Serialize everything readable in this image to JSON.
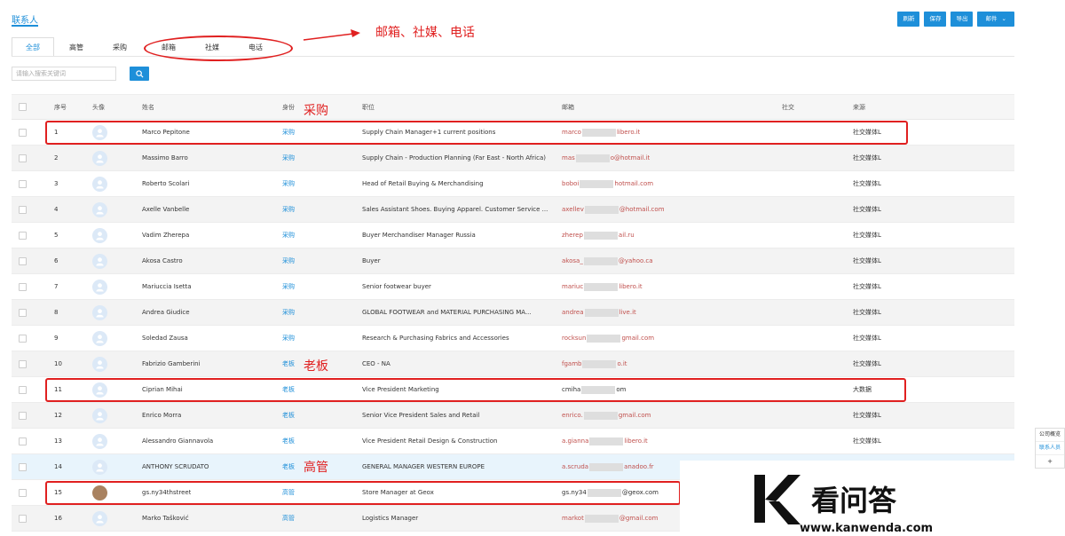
{
  "page": {
    "title": "联系人"
  },
  "tabs": [
    "全部",
    "高管",
    "采购",
    "邮箱",
    "社媒",
    "电话"
  ],
  "search": {
    "placeholder": "请输入搜索关键词"
  },
  "toolbar": {
    "refresh": "刷新",
    "save": "保存",
    "export": "导出",
    "mail": "邮件"
  },
  "table": {
    "headers": {
      "index": "序号",
      "avatar": "头像",
      "name": "姓名",
      "role": "身份",
      "position": "职位",
      "email": "邮箱",
      "social": "社交",
      "source": "来源"
    },
    "rows": [
      {
        "index": "1",
        "name": "Marco Pepitone",
        "role": "采购",
        "position": "Supply Chain Manager+1 current positions",
        "email_prefix": "marco",
        "email_suffix": "libero.it",
        "source": "社交媒体L"
      },
      {
        "index": "2",
        "name": "Massimo Barro",
        "role": "采购",
        "position": "Supply Chain - Production Planning (Far East - North Africa)",
        "email_prefix": "mas",
        "email_suffix": "o@hotmail.it",
        "source": "社交媒体L"
      },
      {
        "index": "3",
        "name": "Roberto Scolari",
        "role": "采购",
        "position": "Head of Retail Buying & Merchandising",
        "email_prefix": "boboi",
        "email_suffix": "hotmail.com",
        "source": "社交媒体L"
      },
      {
        "index": "4",
        "name": "Axelle Vanbelle",
        "role": "采购",
        "position": "Sales Assistant Shoes. Buying Apparel. Customer Service ...",
        "email_prefix": "axellev",
        "email_suffix": "@hotmail.com",
        "source": "社交媒体L"
      },
      {
        "index": "5",
        "name": "Vadim Zherepa",
        "role": "采购",
        "position": "Buyer Merchandiser Manager Russia",
        "email_prefix": "zherep",
        "email_suffix": "ail.ru",
        "source": "社交媒体L"
      },
      {
        "index": "6",
        "name": "Akosa Castro",
        "role": "采购",
        "position": "Buyer",
        "email_prefix": "akosa_",
        "email_suffix": "@yahoo.ca",
        "source": "社交媒体L"
      },
      {
        "index": "7",
        "name": "Mariuccia Isetta",
        "role": "采购",
        "position": "Senior footwear buyer",
        "email_prefix": "mariuc",
        "email_suffix": "libero.it",
        "source": "社交媒体L"
      },
      {
        "index": "8",
        "name": "Andrea Giudice",
        "role": "采购",
        "position": "GLOBAL FOOTWEAR and MATERIAL PURCHASING MA...",
        "email_prefix": "andrea",
        "email_suffix": "live.it",
        "source": "社交媒体L"
      },
      {
        "index": "9",
        "name": "Soledad Zausa",
        "role": "采购",
        "position": "Research & Purchasing Fabrics and Accessories",
        "email_prefix": "rocksun",
        "email_suffix": "gmail.com",
        "source": "社交媒体L"
      },
      {
        "index": "10",
        "name": "Fabrizio Gamberini",
        "role": "老板",
        "position": "CEO - NA",
        "email_prefix": "fgamb",
        "email_suffix": "o.it",
        "source": "社交媒体L"
      },
      {
        "index": "11",
        "name": "Ciprian Mihai",
        "role": "老板",
        "position": "Vice President Marketing",
        "email_prefix": "cmiha",
        "email_suffix": "om",
        "source": "大数据"
      },
      {
        "index": "12",
        "name": "Enrico Morra",
        "role": "老板",
        "position": "Senior Vice President Sales and Retail",
        "email_prefix": "enrico.",
        "email_suffix": "gmail.com",
        "source": "社交媒体L"
      },
      {
        "index": "13",
        "name": "Alessandro Giannavola",
        "role": "老板",
        "position": "Vice President Retail Design & Construction",
        "email_prefix": "a.gianna",
        "email_suffix": "libero.it",
        "source": "社交媒体L"
      },
      {
        "index": "14",
        "name": "ANTHONY SCRUDATO",
        "role": "老板",
        "position": "GENERAL MANAGER WESTERN EUROPE",
        "email_prefix": "a.scruda",
        "email_suffix": "anadoo.fr",
        "source": ""
      },
      {
        "index": "15",
        "name": "gs.ny34thstreet",
        "role": "高管",
        "position": "Store Manager at Geox",
        "email_prefix": "gs.ny34",
        "email_suffix": "@geox.com",
        "source": ""
      },
      {
        "index": "16",
        "name": "Marko Tašković",
        "role": "高管",
        "position": "Logistics Manager",
        "email_prefix": "markot",
        "email_suffix": "@gmail.com",
        "source": ""
      }
    ]
  },
  "annotations": {
    "tabs_note": "邮箱、社媒、电话",
    "purchasing": "采购",
    "boss": "老板",
    "executive": "高管"
  },
  "side_panel": {
    "items": [
      "公司概览",
      "联系人员",
      "+"
    ]
  },
  "colors": {
    "accent": "#1e8fd9",
    "annotation": "#e02020",
    "email": "#c0504d"
  }
}
